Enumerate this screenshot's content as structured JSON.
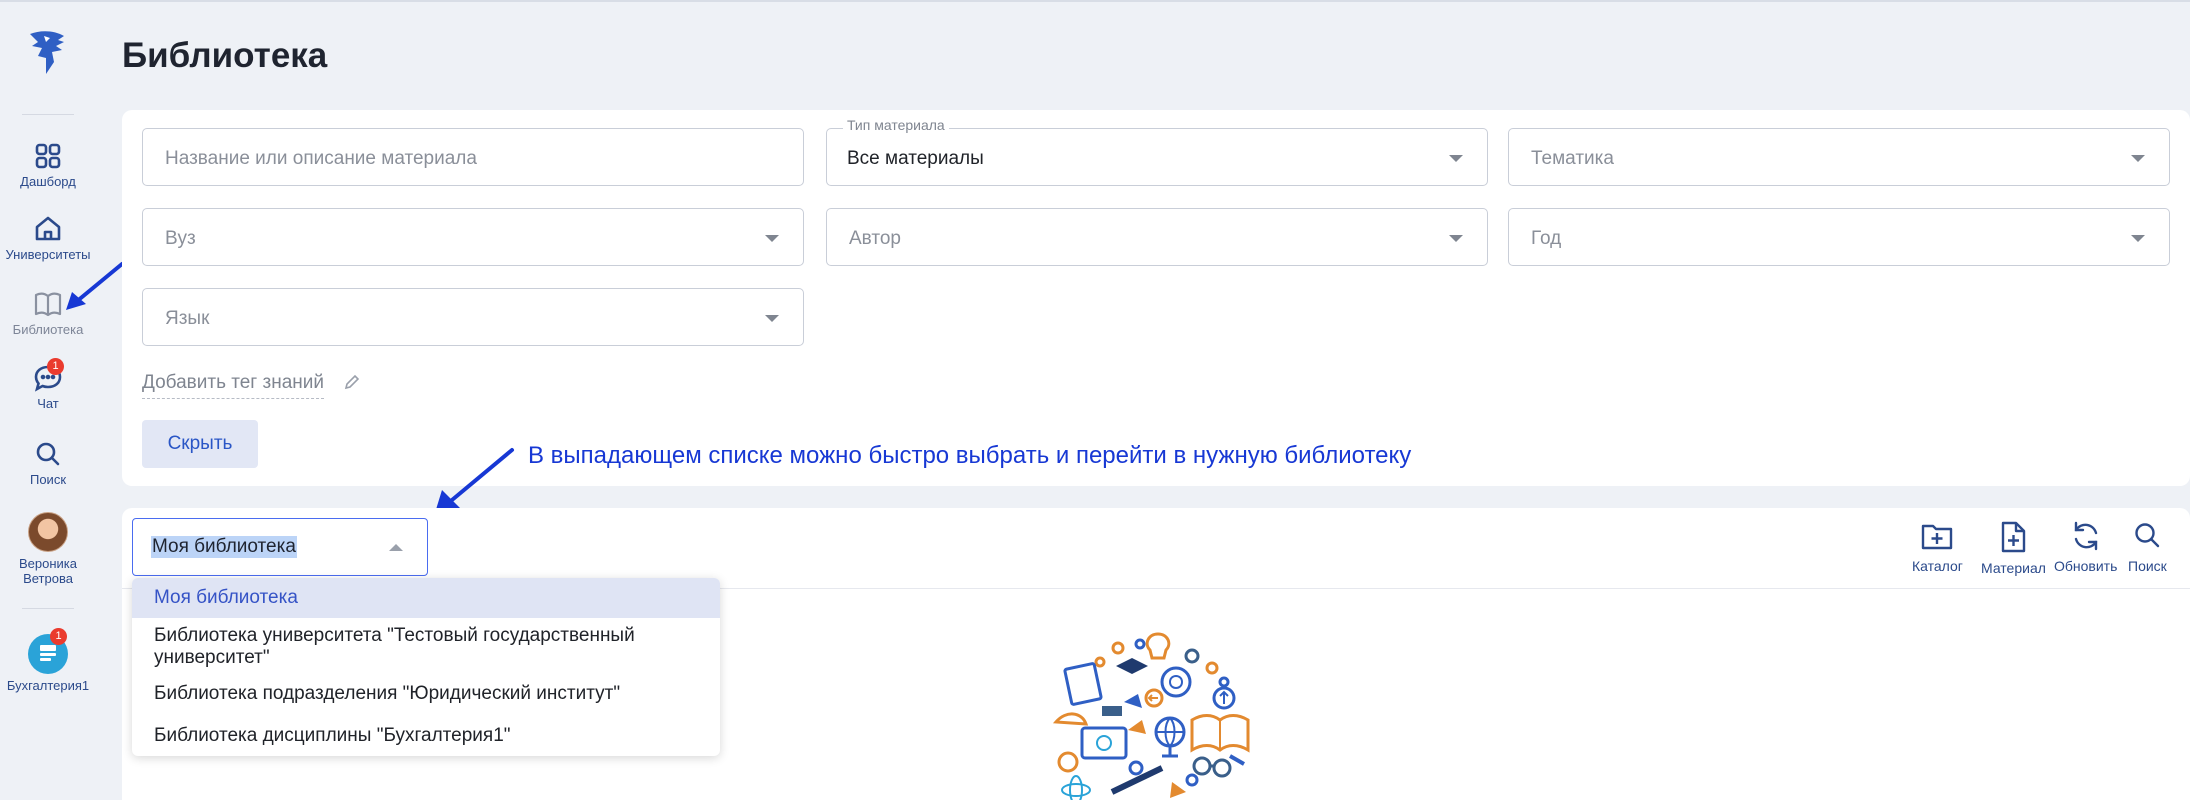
{
  "page": {
    "title": "Библиотека"
  },
  "sidebar": {
    "items": [
      {
        "label": "Дашборд",
        "icon": "grid-icon"
      },
      {
        "label": "Университеты",
        "icon": "home-icon"
      },
      {
        "label": "Библиотека",
        "icon": "book-icon"
      },
      {
        "label": "Чат",
        "icon": "chat-icon",
        "badge": "1"
      },
      {
        "label": "Поиск",
        "icon": "search-icon"
      },
      {
        "label": "Вероника\nВетрова",
        "icon": "avatar"
      },
      {
        "label": "Бухгалтерия1",
        "icon": "accounting-icon",
        "badge": "1"
      }
    ]
  },
  "filters": {
    "name_placeholder": "Название или описание материала",
    "type_label": "Тип материала",
    "type_value": "Все материалы",
    "topic_placeholder": "Тематика",
    "university_placeholder": "Вуз",
    "author_placeholder": "Автор",
    "year_placeholder": "Год",
    "language_placeholder": "Язык",
    "add_tag": "Добавить тег знаний",
    "hide_button": "Скрыть"
  },
  "annotation": "В выпадающем списке можно быстро выбрать и перейти в нужную библиотеку",
  "library": {
    "selected": "Моя библиотека",
    "options": [
      "Моя библиотека",
      "Библиотека университета \"Тестовый государственный университет\"",
      "Библиотека подразделения \"Юридический институт\"",
      "Библиотека дисциплины \"Бухгалтерия1\""
    ],
    "toolbar": {
      "catalog": "Каталог",
      "material": "Материал",
      "refresh": "Обновить",
      "search": "Поиск"
    }
  },
  "colors": {
    "accent": "#2a56c6",
    "nav_text": "#2b4a8b",
    "annotation": "#1738d4",
    "badge": "#ea3b2e"
  }
}
